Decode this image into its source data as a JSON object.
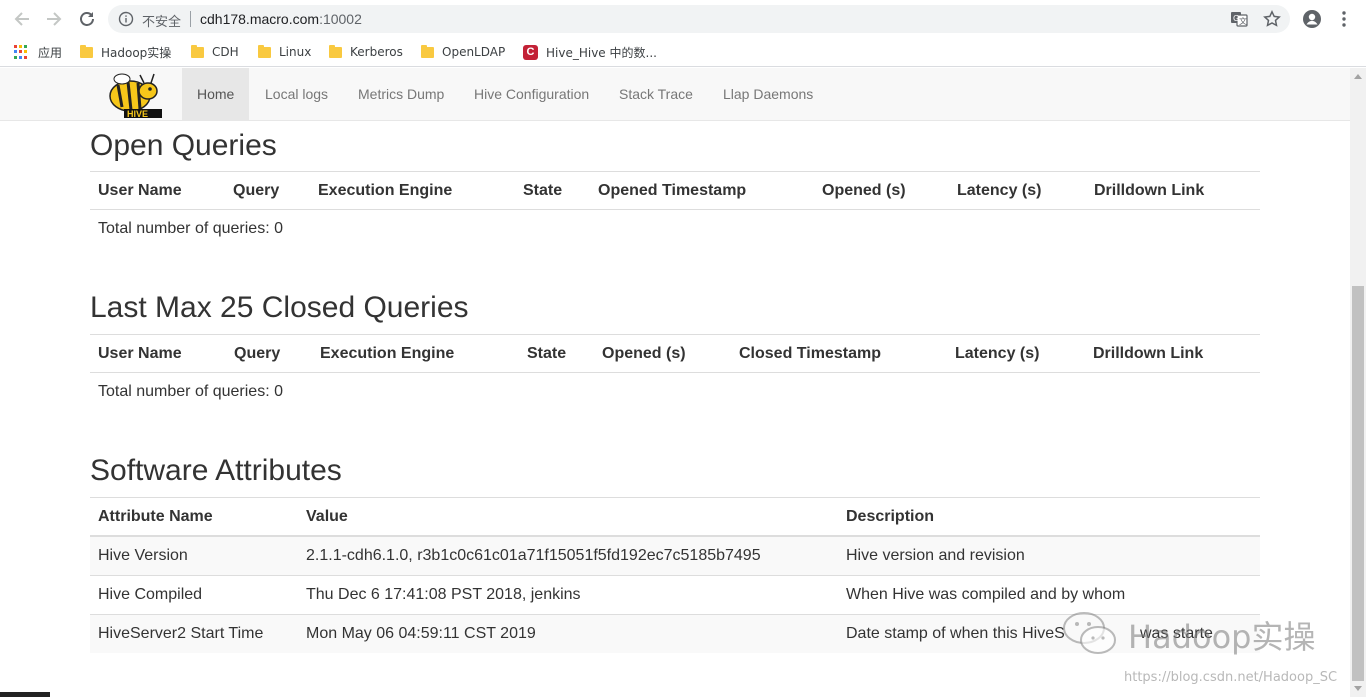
{
  "browser": {
    "insecure_label": "不安全",
    "url_host": "cdh178.macro.com",
    "url_port": ":10002"
  },
  "bookmarks": [
    {
      "label": "应用",
      "icon": "apps-grid-icon"
    },
    {
      "label": "Hadoop实操",
      "icon": "folder-icon"
    },
    {
      "label": "CDH",
      "icon": "folder-icon"
    },
    {
      "label": "Linux",
      "icon": "folder-icon"
    },
    {
      "label": "Kerberos",
      "icon": "folder-icon"
    },
    {
      "label": "OpenLDAP",
      "icon": "folder-icon"
    },
    {
      "label": "Hive_Hive 中的数...",
      "icon": "csdn-icon"
    }
  ],
  "navbar": {
    "logo_text": "HIVE",
    "links": [
      "Home",
      "Local logs",
      "Metrics Dump",
      "Hive Configuration",
      "Stack Trace",
      "Llap Daemons"
    ],
    "active": "Home"
  },
  "open_queries": {
    "title": "Open Queries",
    "columns": [
      "User Name",
      "Query",
      "Execution Engine",
      "State",
      "Opened Timestamp",
      "Opened (s)",
      "Latency (s)",
      "Drilldown Link"
    ],
    "total_text": "Total number of queries: 0"
  },
  "closed_queries": {
    "title": "Last Max 25 Closed Queries",
    "columns": [
      "User Name",
      "Query",
      "Execution Engine",
      "State",
      "Opened (s)",
      "Closed Timestamp",
      "Latency (s)",
      "Drilldown Link"
    ],
    "total_text": "Total number of queries: 0"
  },
  "software_attributes": {
    "title": "Software Attributes",
    "columns": [
      "Attribute Name",
      "Value",
      "Description"
    ],
    "rows": [
      [
        "Hive Version",
        "2.1.1-cdh6.1.0, r3b1c0c61c01a71f15051f5fd192ec7c5185b7495",
        "Hive version and revision"
      ],
      [
        "Hive Compiled",
        "Thu Dec 6 17:41:08 PST 2018, jenkins",
        "When Hive was compiled and by whom"
      ],
      [
        "HiveServer2 Start Time",
        "Mon May 06 04:59:11 CST 2019",
        "Date stamp of when this HiveS"
      ]
    ],
    "desc_tail": "was starte"
  },
  "watermark": {
    "brand": "Hadoop实操",
    "url": "https://blog.csdn.net/Hadoop_SC"
  },
  "colors": {
    "navbar_bg": "#f8f8f8",
    "text": "#333333",
    "link": "#777777",
    "folder": "#f9c940",
    "csdn_red": "#c32136"
  }
}
